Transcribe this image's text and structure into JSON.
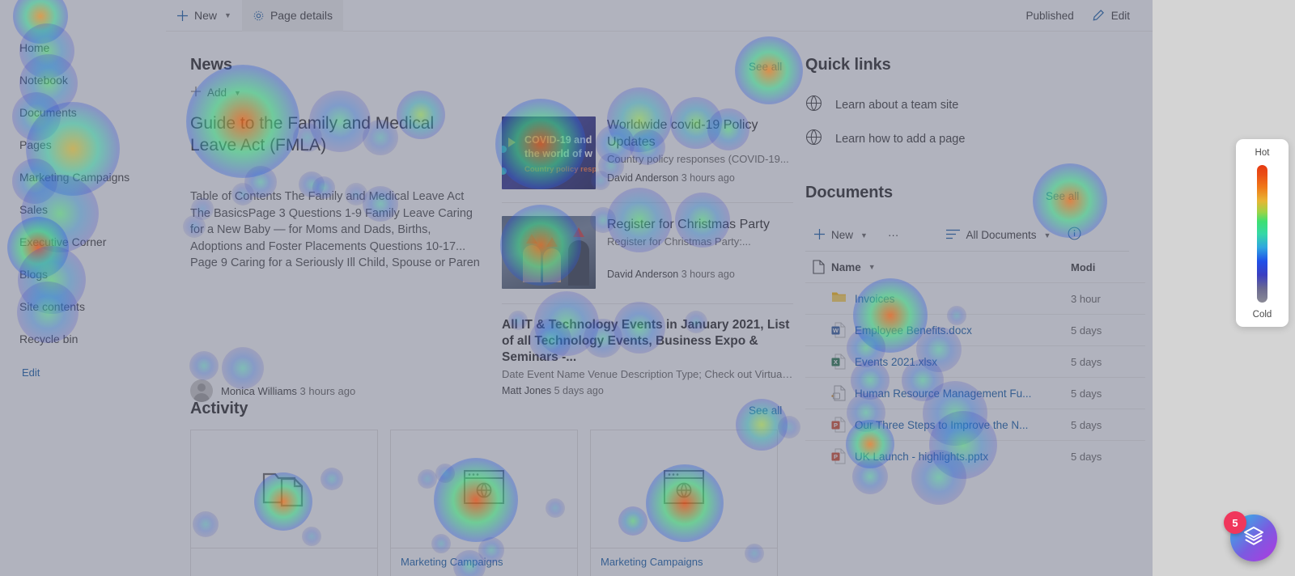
{
  "commandbar": {
    "new_label": "New",
    "page_details_label": "Page details",
    "published_label": "Published",
    "edit_label": "Edit"
  },
  "sidebar": {
    "items": [
      {
        "label": "Home"
      },
      {
        "label": "Notebook"
      },
      {
        "label": "Documents"
      },
      {
        "label": "Pages"
      },
      {
        "label": "Marketing Campaigns"
      },
      {
        "label": "Sales"
      },
      {
        "label": "Executive Corner"
      },
      {
        "label": "Blogs"
      },
      {
        "label": "Site contents"
      },
      {
        "label": "Recycle bin"
      }
    ],
    "edit_label": "Edit"
  },
  "news": {
    "title": "News",
    "add_label": "Add",
    "see_all_label": "See all",
    "hero": {
      "title": "Guide to the Family and Medical Leave Act (FMLA)",
      "description": "Table of Contents The Family and Medical Leave Act The BasicsPage 3 Questions 1-9 Family Leave Caring for a New Baby — for Moms and Dads, Births, Adoptions and Foster Placements Questions 10-17... Page 9 Caring for a Seriously Ill Child, Spouse or Paren",
      "author": "Monica Williams",
      "time": "3 hours ago"
    },
    "items": [
      {
        "title": "Worldwide covid-19 Policy Updates",
        "subtitle": "Country policy responses (COVID-19...",
        "author": "David Anderson",
        "time": "3 hours ago",
        "thumb_line1": "COVID-19 and",
        "thumb_line2": "the world of w",
        "thumb_line3": "Country policy resp"
      },
      {
        "title": "Register for Christmas Party",
        "subtitle": "Register for Christmas Party:...",
        "author": "David Anderson",
        "time": "3 hours ago"
      }
    ],
    "wide_item": {
      "title": "All IT & Technology Events in January 2021, List of all Technology Events, Business Expo & Seminars -...",
      "subtitle": "Date Event Name Venue Description Type; Check out Virtual ...",
      "author": "Matt Jones",
      "time": "5 days ago"
    }
  },
  "activity": {
    "title": "Activity",
    "see_all_label": "See all",
    "cards": [
      {
        "icon": "folder-document-icon",
        "label": ""
      },
      {
        "icon": "webpage-icon",
        "label": "Marketing Campaigns"
      },
      {
        "icon": "webpage-icon",
        "label": "Marketing Campaigns"
      }
    ]
  },
  "quick_links": {
    "title": "Quick links",
    "items": [
      {
        "label": "Learn about a team site",
        "icon": "globe-icon"
      },
      {
        "label": "Learn how to add a page",
        "icon": "globe-icon"
      }
    ]
  },
  "documents": {
    "title": "Documents",
    "see_all_label": "See all",
    "toolbar": {
      "new_label": "New",
      "more_label": "···",
      "view_label": "All Documents"
    },
    "columns": {
      "name": "Name",
      "modified": "Modi"
    },
    "rows": [
      {
        "name": "Invoices",
        "modified": "3 hour",
        "icon": "folder-icon"
      },
      {
        "name": "Employee Benefits.docx",
        "modified": "5 days",
        "icon": "word-icon"
      },
      {
        "name": "Events 2021.xlsx",
        "modified": "5 days",
        "icon": "excel-icon"
      },
      {
        "name": "Human Resource Management Fu...",
        "modified": "5 days",
        "icon": "generic-file-icon"
      },
      {
        "name": "Our Three Steps to Improve the N...",
        "modified": "5 days",
        "icon": "powerpoint-icon"
      },
      {
        "name": "UK Launch - highlights.pptx",
        "modified": "5 days",
        "icon": "powerpoint-icon"
      }
    ]
  },
  "legend": {
    "hot_label": "Hot",
    "cold_label": "Cold",
    "hot_color": "#e63a12",
    "cold_color": "#8a8a96"
  },
  "fab": {
    "badge_count": "5",
    "icon": "layers-icon",
    "gradient_from": "#25c2e8",
    "gradient_to": "#b038e0"
  }
}
